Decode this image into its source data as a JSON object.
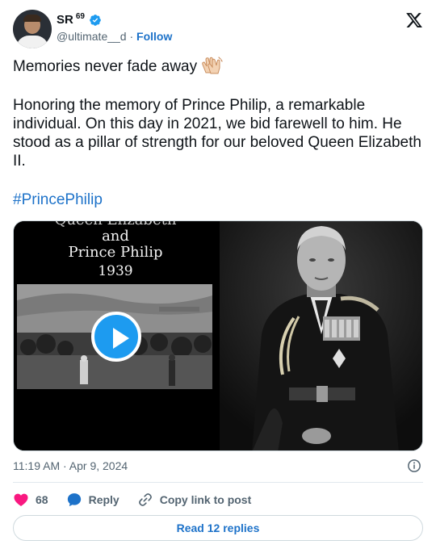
{
  "author": {
    "name": "SR",
    "superscript": "69",
    "handle": "@ultimate__d",
    "separator": "·",
    "follow_label": "Follow"
  },
  "tweet": {
    "line1": "Memories never fade away",
    "body": "Honoring the memory of Prince Philip, a remarkable individual. On this day in 2021, we bid farewell to him. He stood as a pillar of strength for our beloved Queen Elizabeth II.",
    "hashtag": "#PrincePhilip"
  },
  "media": {
    "left_caption_top": "Queen Elizabeth",
    "left_caption_mid": "and",
    "left_caption_name": "Prince Philip",
    "left_caption_year": "1939"
  },
  "meta": {
    "timestamp": "11:19 AM · Apr 9, 2024"
  },
  "actions": {
    "like_count": "68",
    "reply_label": "Reply",
    "copy_label": "Copy link to post"
  },
  "read_replies_label": "Read 12 replies",
  "colors": {
    "accent_blue": "#1d9bf0",
    "link_blue": "#1d72c9",
    "like_red": "#f91880",
    "muted": "#536471"
  },
  "icons": [
    "verified-badge-icon",
    "x-logo-icon",
    "clapping-hands-icon",
    "play-icon",
    "info-icon",
    "heart-icon",
    "reply-bubble-icon",
    "link-icon"
  ]
}
